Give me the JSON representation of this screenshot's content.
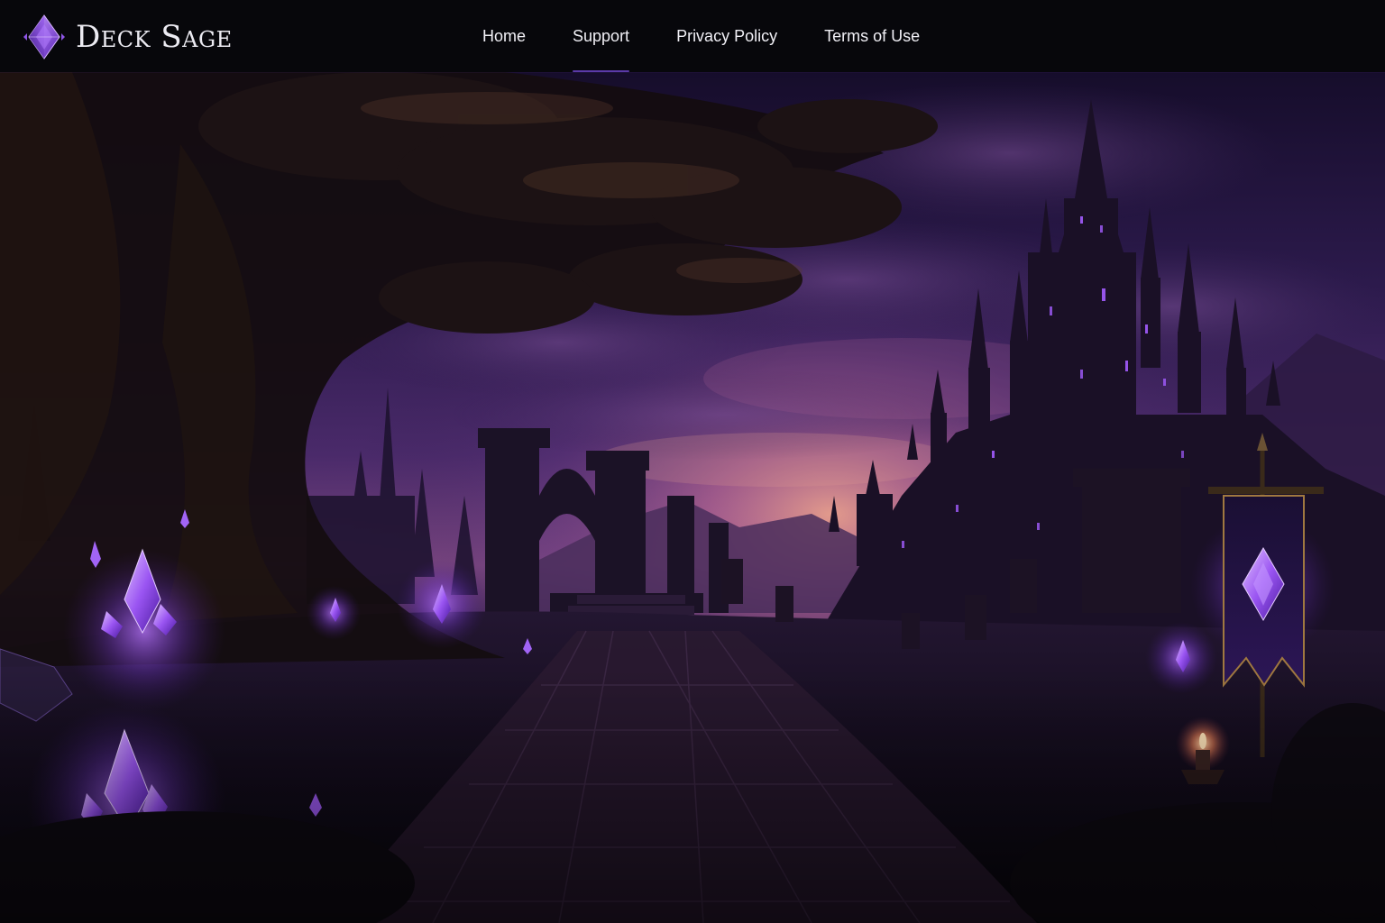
{
  "brand": {
    "name": "Deck Sage",
    "logo_icon": "purple-crystal-icon"
  },
  "nav": {
    "items": [
      {
        "label": "Home"
      },
      {
        "label": "Support",
        "active": true
      },
      {
        "label": "Privacy Policy"
      },
      {
        "label": "Terms of Use"
      }
    ]
  },
  "colors": {
    "nav_background": "#07070b",
    "nav_text": "#f1f0f6",
    "active_underline": "#5b3aa8",
    "crystal_glow": "#a35cff",
    "sky_dusk": "#c9719a"
  },
  "hero": {
    "scene": "dark-fantasy-landscape"
  }
}
